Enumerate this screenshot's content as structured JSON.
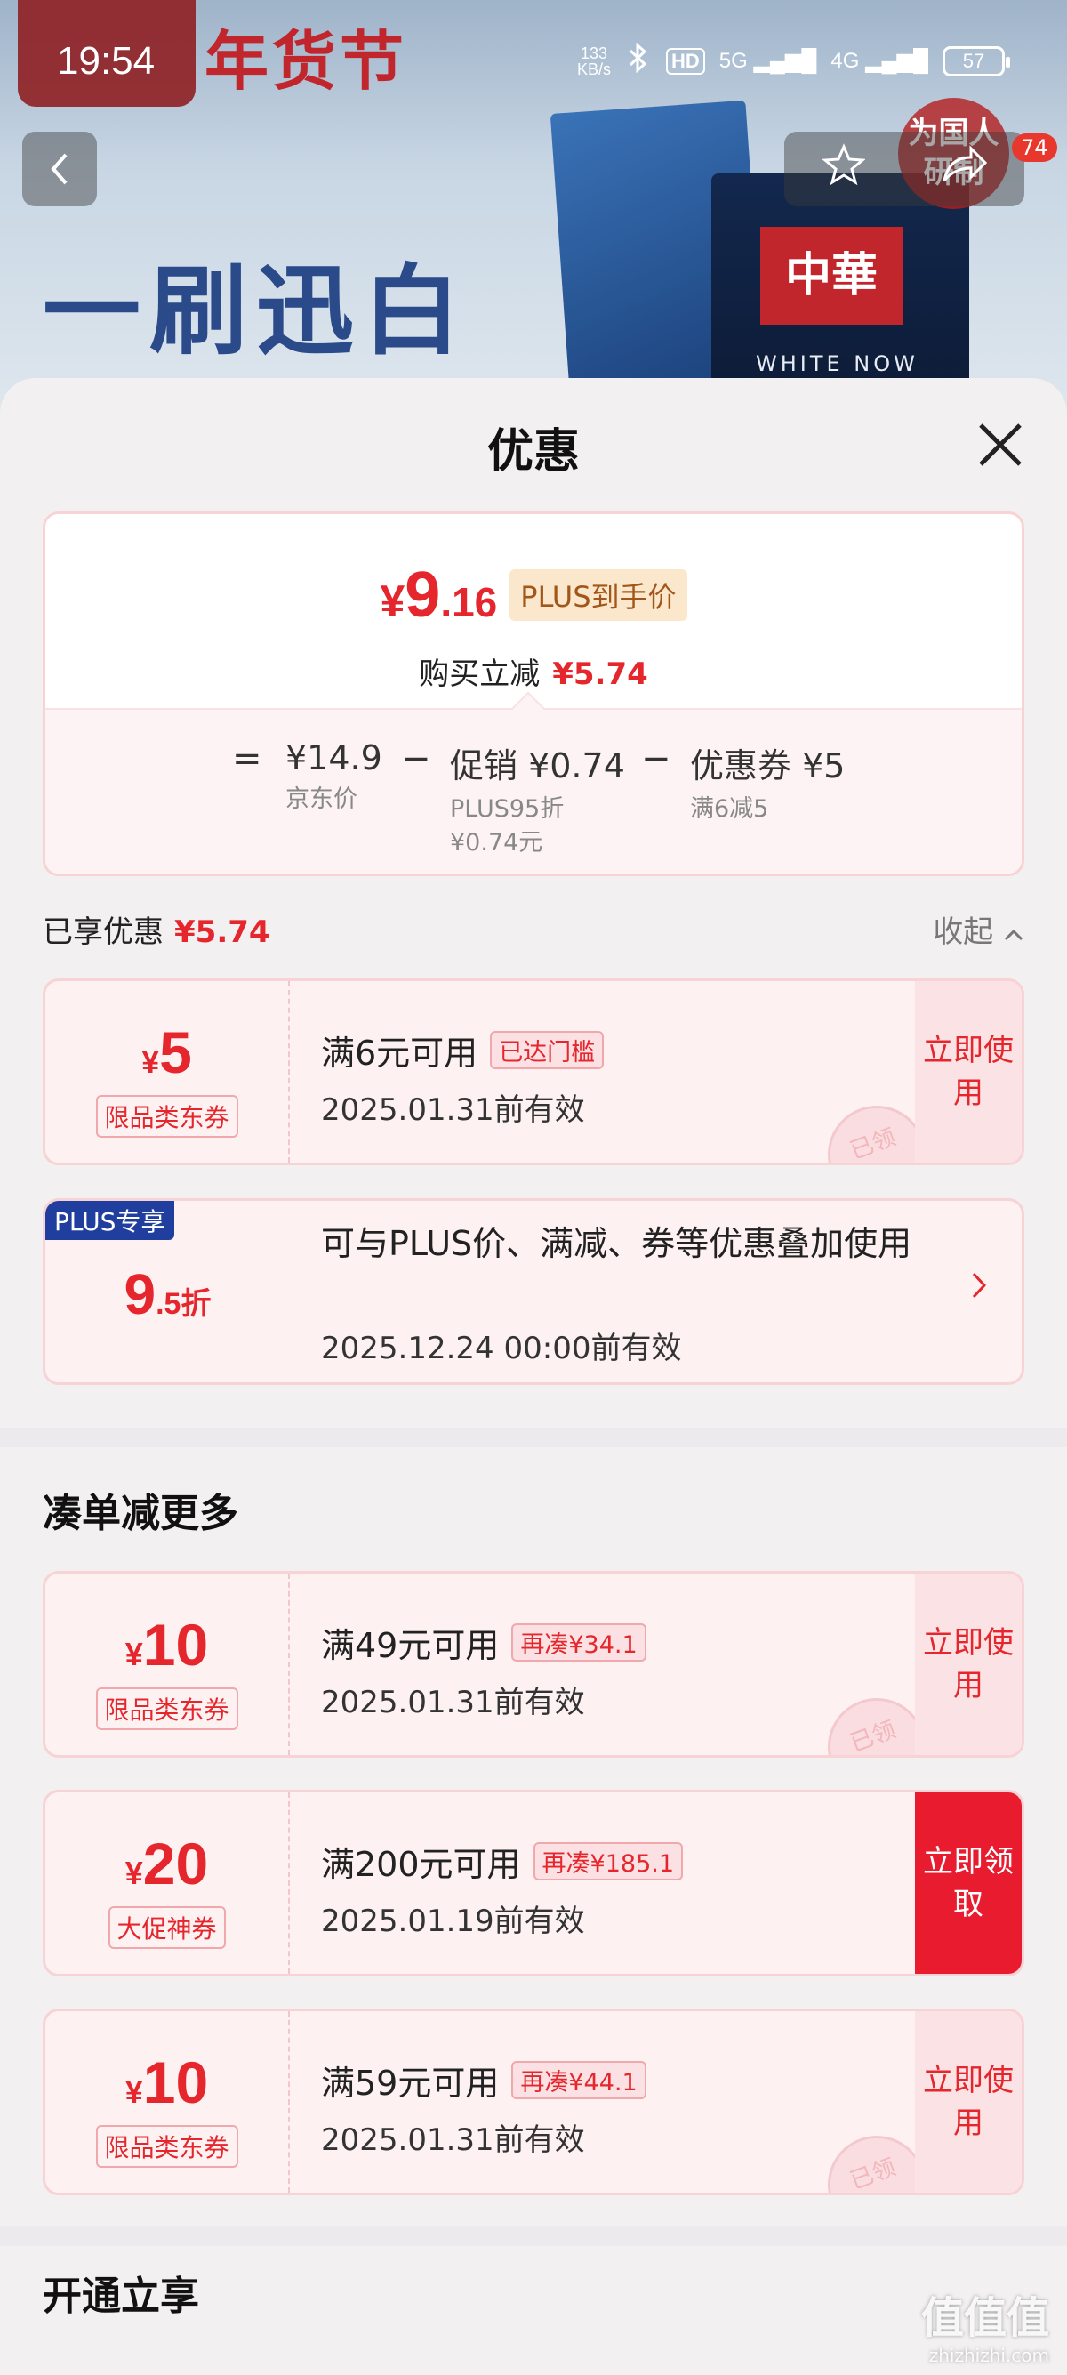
{
  "status": {
    "time": "19:54",
    "speed_top": "133",
    "speed_bottom": "KB/s",
    "hd": "HD",
    "net5g": "5G",
    "net4g": "4G",
    "battery": "57"
  },
  "background": {
    "festival": "年货节",
    "slogan": "一刷迅白",
    "box_brand": "中華",
    "box_tagline": "WHITE NOW",
    "seal": "为国人研制",
    "badge": "74"
  },
  "sheet": {
    "title": "优惠"
  },
  "summary": {
    "yen": "¥",
    "price_int": "9",
    "price_dec": ".16",
    "plus_tag": "PLUS到手价",
    "instant_label": "购买立减",
    "instant_amount": "¥5.74",
    "eq": "=",
    "minus": "−",
    "jd_price": "¥14.9",
    "jd_label": "京东价",
    "promo_main": "促销 ¥0.74",
    "promo_sub1": "PLUS95折",
    "promo_sub2": "¥0.74元",
    "coupon_main": "优惠券 ¥5",
    "coupon_sub": "满6减5"
  },
  "enjoyed": {
    "label": "已享优惠",
    "amount": "¥5.74",
    "collapse": "收起"
  },
  "coupons_used": [
    {
      "yen": "¥",
      "amount": "5",
      "type": "限品类东券",
      "condition": "满6元可用",
      "tag": "已达门槛",
      "date": "2025.01.31前有效",
      "action": "立即使用",
      "stamp": "已领"
    }
  ],
  "plus_card": {
    "flag": "PLUS专享",
    "disc_num": "9",
    "disc_rest": ".5折",
    "desc": "可与PLUS价、满减、券等优惠叠加使用",
    "date": "2025.12.24 00:00前有效"
  },
  "more_section": {
    "title": "凑单减更多"
  },
  "coupons_more": [
    {
      "yen": "¥",
      "amount": "10",
      "type": "限品类东券",
      "condition": "满49元可用",
      "tag": "再凑¥34.1",
      "date": "2025.01.31前有效",
      "action": "立即使用",
      "stamp": "已领"
    },
    {
      "yen": "¥",
      "amount": "20",
      "type": "大促神券",
      "condition": "满200元可用",
      "tag": "再凑¥185.1",
      "date": "2025.01.19前有效",
      "action": "立即领取"
    },
    {
      "yen": "¥",
      "amount": "10",
      "type": "限品类东券",
      "condition": "满59元可用",
      "tag": "再凑¥44.1",
      "date": "2025.01.31前有效",
      "action": "立即使用",
      "stamp": "已领"
    }
  ],
  "open_section": {
    "title": "开通立享"
  },
  "watermark": {
    "logo": "值值值",
    "url": "zhizhizhi.com"
  },
  "colors": {
    "accent_red": "#e5262c",
    "plus_blue": "#1f3e9e",
    "plus_gold_bg": "#fbe8cc"
  }
}
